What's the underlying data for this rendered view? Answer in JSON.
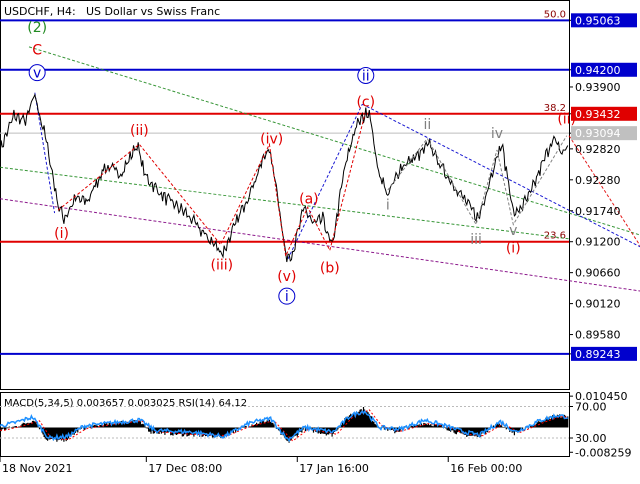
{
  "header": {
    "symbol": "USDCHF, H4:",
    "description": "US Dollar vs Swiss Franc"
  },
  "colors": {
    "price": "#000000",
    "grid_tick": "#000000",
    "level_blue": "#0000cd",
    "level_red": "#e00000",
    "fib_level": "#8b0000",
    "wave_red": "#e00000",
    "wave_blue": "#0000cd",
    "wave_green": "#228b22",
    "wave_gray": "#808080",
    "bid_line": "#bebebe",
    "label_blue_bg": "#0000cd",
    "label_red_bg": "#e00000",
    "label_gray_bg": "#c0c0c0",
    "macd_hist": "#000000",
    "macd_signal": "#ff0000",
    "rsi_line": "#1e90ff"
  },
  "chart_data": {
    "type": "line",
    "title": "USDCHF, H4: US Dollar vs Swiss Franc",
    "ylim": [
      0.8863,
      0.954
    ],
    "y_ticks": [
      "0.95063",
      "0.94200",
      "0.93432",
      "0.93094",
      "0.92820",
      "0.92280",
      "0.91740",
      "0.91200",
      "0.90660",
      "0.90120",
      "0.89580",
      "0.89243",
      "0.93900"
    ],
    "y_tick_values": [
      0.95063,
      0.942,
      0.93432,
      0.93094,
      0.9282,
      0.9228,
      0.9174,
      0.912,
      0.9066,
      0.9012,
      0.8958,
      0.89243,
      0.939
    ],
    "x_ticks": [
      "18 Nov 2021",
      "17 Dec 08:00",
      "17 Jan 16:00",
      "16 Feb 00:00"
    ],
    "x_tick_bars": [
      0,
      126,
      256,
      386
    ],
    "bars_total": 490,
    "price_anchors": [
      [
        0,
        0.928
      ],
      [
        12,
        0.934
      ],
      [
        22,
        0.933
      ],
      [
        30,
        0.9375
      ],
      [
        40,
        0.9295
      ],
      [
        50,
        0.9185
      ],
      [
        55,
        0.916
      ],
      [
        65,
        0.9195
      ],
      [
        75,
        0.919
      ],
      [
        90,
        0.925
      ],
      [
        105,
        0.924
      ],
      [
        118,
        0.929
      ],
      [
        125,
        0.9235
      ],
      [
        140,
        0.92
      ],
      [
        160,
        0.917
      ],
      [
        175,
        0.9135
      ],
      [
        192,
        0.91
      ],
      [
        205,
        0.916
      ],
      [
        218,
        0.922
      ],
      [
        231,
        0.9285
      ],
      [
        238,
        0.922
      ],
      [
        246,
        0.9095
      ],
      [
        252,
        0.91
      ],
      [
        262,
        0.918
      ],
      [
        270,
        0.915
      ],
      [
        278,
        0.916
      ],
      [
        286,
        0.911
      ],
      [
        296,
        0.924
      ],
      [
        306,
        0.932
      ],
      [
        318,
        0.935
      ],
      [
        325,
        0.925
      ],
      [
        334,
        0.92
      ],
      [
        345,
        0.925
      ],
      [
        360,
        0.927
      ],
      [
        370,
        0.929
      ],
      [
        380,
        0.925
      ],
      [
        394,
        0.921
      ],
      [
        412,
        0.916
      ],
      [
        425,
        0.925
      ],
      [
        432,
        0.929
      ],
      [
        443,
        0.9165
      ],
      [
        456,
        0.92
      ],
      [
        466,
        0.925
      ],
      [
        476,
        0.93
      ],
      [
        484,
        0.9275
      ],
      [
        489,
        0.9285
      ]
    ],
    "levels": [
      {
        "value": 0.95063,
        "label": "0.95063",
        "color": "blue",
        "fib": "50.0"
      },
      {
        "value": 0.942,
        "label": "0.94200",
        "color": "blue"
      },
      {
        "value": 0.93432,
        "label": "0.93432",
        "color": "red",
        "fib": "38.2"
      },
      {
        "value": 0.912,
        "label": "",
        "color": "red",
        "fib": "23.6"
      },
      {
        "value": 0.89243,
        "label": "0.89243",
        "color": "blue"
      }
    ],
    "bid": {
      "value": 0.93094,
      "label": "0.93094"
    },
    "trendlines": [
      {
        "color": "green",
        "from": [
          0,
          0.925
        ],
        "to": [
          490,
          0.9125
        ]
      },
      {
        "color": "green",
        "from": [
          25,
          0.946
        ],
        "to": [
          570,
          0.912
        ]
      },
      {
        "color": "purple",
        "from": [
          0,
          0.9195
        ],
        "to": [
          565,
          0.903
        ]
      },
      {
        "color": "blue",
        "from": [
          30,
          0.938
        ],
        "to": [
          47,
          0.917
        ]
      },
      {
        "color": "blue",
        "from": [
          248,
          0.909
        ],
        "to": [
          312,
          0.936
        ]
      },
      {
        "color": "blue",
        "from": [
          312,
          0.936
        ],
        "to": [
          562,
          0.91
        ]
      },
      {
        "color": "red",
        "from": [
          490,
          0.9305
        ],
        "to": [
          565,
          0.907
        ]
      }
    ],
    "wave_path_red": [
      [
        50,
        0.9175
      ],
      [
        120,
        0.929
      ],
      [
        190,
        0.9115
      ],
      [
        232,
        0.929
      ],
      [
        246,
        0.9095
      ],
      [
        265,
        0.918
      ],
      [
        284,
        0.9105
      ],
      [
        314,
        0.934
      ]
    ],
    "wave_path_gray": [
      [
        334,
        0.921
      ],
      [
        368,
        0.93
      ],
      [
        410,
        0.915
      ],
      [
        428,
        0.928
      ],
      [
        442,
        0.915
      ],
      [
        488,
        0.9305
      ]
    ],
    "wave_labels": [
      {
        "text": "(2)",
        "bar": 32,
        "value": 0.9495,
        "color": "green",
        "circle": false
      },
      {
        "text": "C",
        "bar": 32,
        "value": 0.9455,
        "color": "red",
        "circle": false
      },
      {
        "text": "v",
        "bar": 32,
        "value": 0.9415,
        "color": "blue",
        "circle": true
      },
      {
        "text": "(i)",
        "bar": 53,
        "value": 0.9135,
        "color": "red",
        "circle": false
      },
      {
        "text": "(ii)",
        "bar": 120,
        "value": 0.9315,
        "color": "red",
        "circle": false
      },
      {
        "text": "(iii)",
        "bar": 191,
        "value": 0.908,
        "color": "red",
        "circle": false
      },
      {
        "text": "(iv)",
        "bar": 234,
        "value": 0.93,
        "color": "red",
        "circle": false
      },
      {
        "text": "(v)",
        "bar": 247,
        "value": 0.906,
        "color": "red",
        "circle": false
      },
      {
        "text": "i",
        "bar": 247,
        "value": 0.9025,
        "color": "blue",
        "circle": true
      },
      {
        "text": "(a)",
        "bar": 266,
        "value": 0.9195,
        "color": "red",
        "circle": false
      },
      {
        "text": "(b)",
        "bar": 284,
        "value": 0.9075,
        "color": "red",
        "circle": false
      },
      {
        "text": "(c)",
        "bar": 315,
        "value": 0.9365,
        "color": "red",
        "circle": false
      },
      {
        "text": "ii",
        "bar": 315,
        "value": 0.941,
        "color": "blue",
        "circle": true
      },
      {
        "text": "i",
        "bar": 334,
        "value": 0.9185,
        "color": "gray",
        "circle": false
      },
      {
        "text": "ii",
        "bar": 368,
        "value": 0.9325,
        "color": "gray",
        "circle": false
      },
      {
        "text": "iii",
        "bar": 410,
        "value": 0.9125,
        "color": "gray",
        "circle": false
      },
      {
        "text": "iv",
        "bar": 428,
        "value": 0.931,
        "color": "gray",
        "circle": false
      },
      {
        "text": "v",
        "bar": 442,
        "value": 0.914,
        "color": "gray",
        "circle": false
      },
      {
        "text": "(i)",
        "bar": 442,
        "value": 0.911,
        "color": "red",
        "circle": false
      },
      {
        "text": "(ii)",
        "bar": 488,
        "value": 0.9335,
        "color": "red",
        "circle": false
      }
    ]
  },
  "indicator": {
    "title": "MACD(5,34,5) 0.003657 0.003025 RSI(14) 64.12",
    "ylim": [
      -0.0095,
      0.0115
    ],
    "y_ticks": [
      "0.010450",
      "70.00",
      "30.00",
      "-0.008259"
    ],
    "y_tick_values": [
      0.01045,
      0.007,
      -0.0035,
      -0.008259
    ],
    "macd_anchors": [
      [
        0,
        -0.001
      ],
      [
        15,
        0.0005
      ],
      [
        30,
        0.0025
      ],
      [
        40,
        -0.004
      ],
      [
        55,
        -0.0045
      ],
      [
        70,
        -0.0005
      ],
      [
        90,
        0.001
      ],
      [
        118,
        0.0025
      ],
      [
        130,
        -0.0015
      ],
      [
        160,
        -0.0025
      ],
      [
        192,
        -0.003
      ],
      [
        212,
        0.0005
      ],
      [
        232,
        0.0025
      ],
      [
        248,
        -0.005
      ],
      [
        262,
        -0.0005
      ],
      [
        286,
        -0.0025
      ],
      [
        300,
        0.004
      ],
      [
        314,
        0.0065
      ],
      [
        325,
        0.0005
      ],
      [
        340,
        -0.0015
      ],
      [
        365,
        0.0015
      ],
      [
        380,
        0.0005
      ],
      [
        398,
        -0.0025
      ],
      [
        412,
        -0.003
      ],
      [
        430,
        0.0015
      ],
      [
        443,
        -0.002
      ],
      [
        465,
        0.002
      ],
      [
        478,
        0.004
      ],
      [
        489,
        0.0037
      ]
    ],
    "rsi_anchors": [
      [
        0,
        0.0005
      ],
      [
        12,
        0.0015
      ],
      [
        28,
        0.0035
      ],
      [
        42,
        -0.0035
      ],
      [
        58,
        -0.003
      ],
      [
        72,
        0.0005
      ],
      [
        96,
        0.0015
      ],
      [
        120,
        0.0025
      ],
      [
        134,
        -0.001
      ],
      [
        165,
        -0.0015
      ],
      [
        193,
        -0.003
      ],
      [
        215,
        0.0015
      ],
      [
        233,
        0.003
      ],
      [
        248,
        -0.004
      ],
      [
        262,
        0.0
      ],
      [
        287,
        -0.0015
      ],
      [
        302,
        0.004
      ],
      [
        314,
        0.0055
      ],
      [
        327,
        0.0
      ],
      [
        345,
        -0.0005
      ],
      [
        366,
        0.0025
      ],
      [
        384,
        0.0005
      ],
      [
        400,
        -0.0015
      ],
      [
        413,
        -0.0025
      ],
      [
        431,
        0.002
      ],
      [
        444,
        -0.0015
      ],
      [
        466,
        0.0025
      ],
      [
        480,
        0.004
      ],
      [
        489,
        0.0035
      ]
    ]
  }
}
